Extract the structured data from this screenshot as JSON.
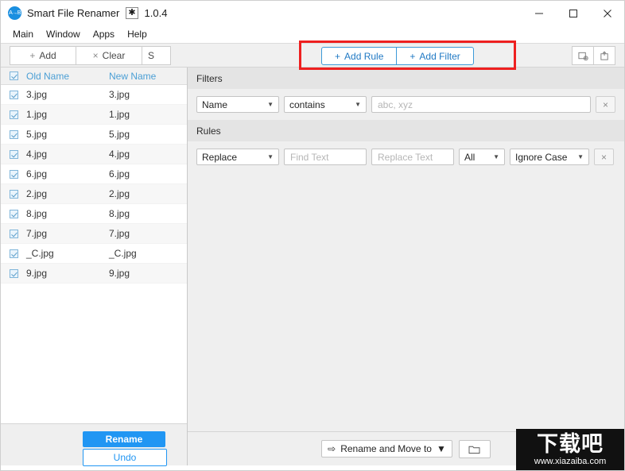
{
  "window": {
    "icon": "app-logo-icon",
    "title": "Smart File Renamer",
    "badge": "✱",
    "version": "1.0.4",
    "minimize": "—",
    "maximize": "☐",
    "close": "✕"
  },
  "menubar": {
    "items": [
      {
        "label": "Main"
      },
      {
        "label": "Window"
      },
      {
        "label": "Apps"
      },
      {
        "label": "Help"
      }
    ]
  },
  "toolbar": {
    "add_label": "Add",
    "add_plus": "+",
    "clear_label": "Clear",
    "clear_x": "×",
    "third_label": "S",
    "add_rule_label": "Add Rule",
    "add_rule_plus": "+",
    "add_filter_label": "Add Filter",
    "add_filter_plus": "+",
    "import_icon": "import-settings-icon",
    "export_icon": "export-settings-icon",
    "highlight_color": "#ee2020"
  },
  "file_list": {
    "columns": {
      "old_name": "Old Name",
      "new_name": "New Name"
    },
    "header_checked": true,
    "rows": [
      {
        "checked": true,
        "old": "3.jpg",
        "new": "3.jpg"
      },
      {
        "checked": true,
        "old": "1.jpg",
        "new": "1.jpg"
      },
      {
        "checked": true,
        "old": "5.jpg",
        "new": "5.jpg"
      },
      {
        "checked": true,
        "old": "4.jpg",
        "new": "4.jpg"
      },
      {
        "checked": true,
        "old": "6.jpg",
        "new": "6.jpg"
      },
      {
        "checked": true,
        "old": "2.jpg",
        "new": "2.jpg"
      },
      {
        "checked": true,
        "old": "8.jpg",
        "new": "8.jpg"
      },
      {
        "checked": true,
        "old": "7.jpg",
        "new": "7.jpg"
      },
      {
        "checked": true,
        "old": "_C.jpg",
        "new": "_C.jpg"
      },
      {
        "checked": true,
        "old": "9.jpg",
        "new": "9.jpg"
      }
    ]
  },
  "left_footer": {
    "rename_label": "Rename",
    "undo_label": "Undo"
  },
  "filters": {
    "section_title": "Filters",
    "rows": [
      {
        "field": "Name",
        "condition": "contains",
        "value": "",
        "value_placeholder": "abc, xyz",
        "remove": "×"
      }
    ]
  },
  "rules": {
    "section_title": "Rules",
    "rows": [
      {
        "action": "Replace",
        "find": "",
        "find_placeholder": "Find Text",
        "replace": "",
        "replace_placeholder": "Replace Text",
        "scope": "All",
        "case": "Ignore Case",
        "remove": "×"
      }
    ]
  },
  "right_footer": {
    "move_arrow": "⇨",
    "move_label": "Rename and Move to",
    "caret": "▼",
    "folder_icon": "folder-icon"
  },
  "watermark": {
    "cn": "下载吧",
    "url": "www.xiazaiba.com"
  },
  "colors": {
    "accent": "#2196f3",
    "link": "#4b9fd5",
    "highlight": "#ee2020",
    "panel": "#efefef"
  }
}
